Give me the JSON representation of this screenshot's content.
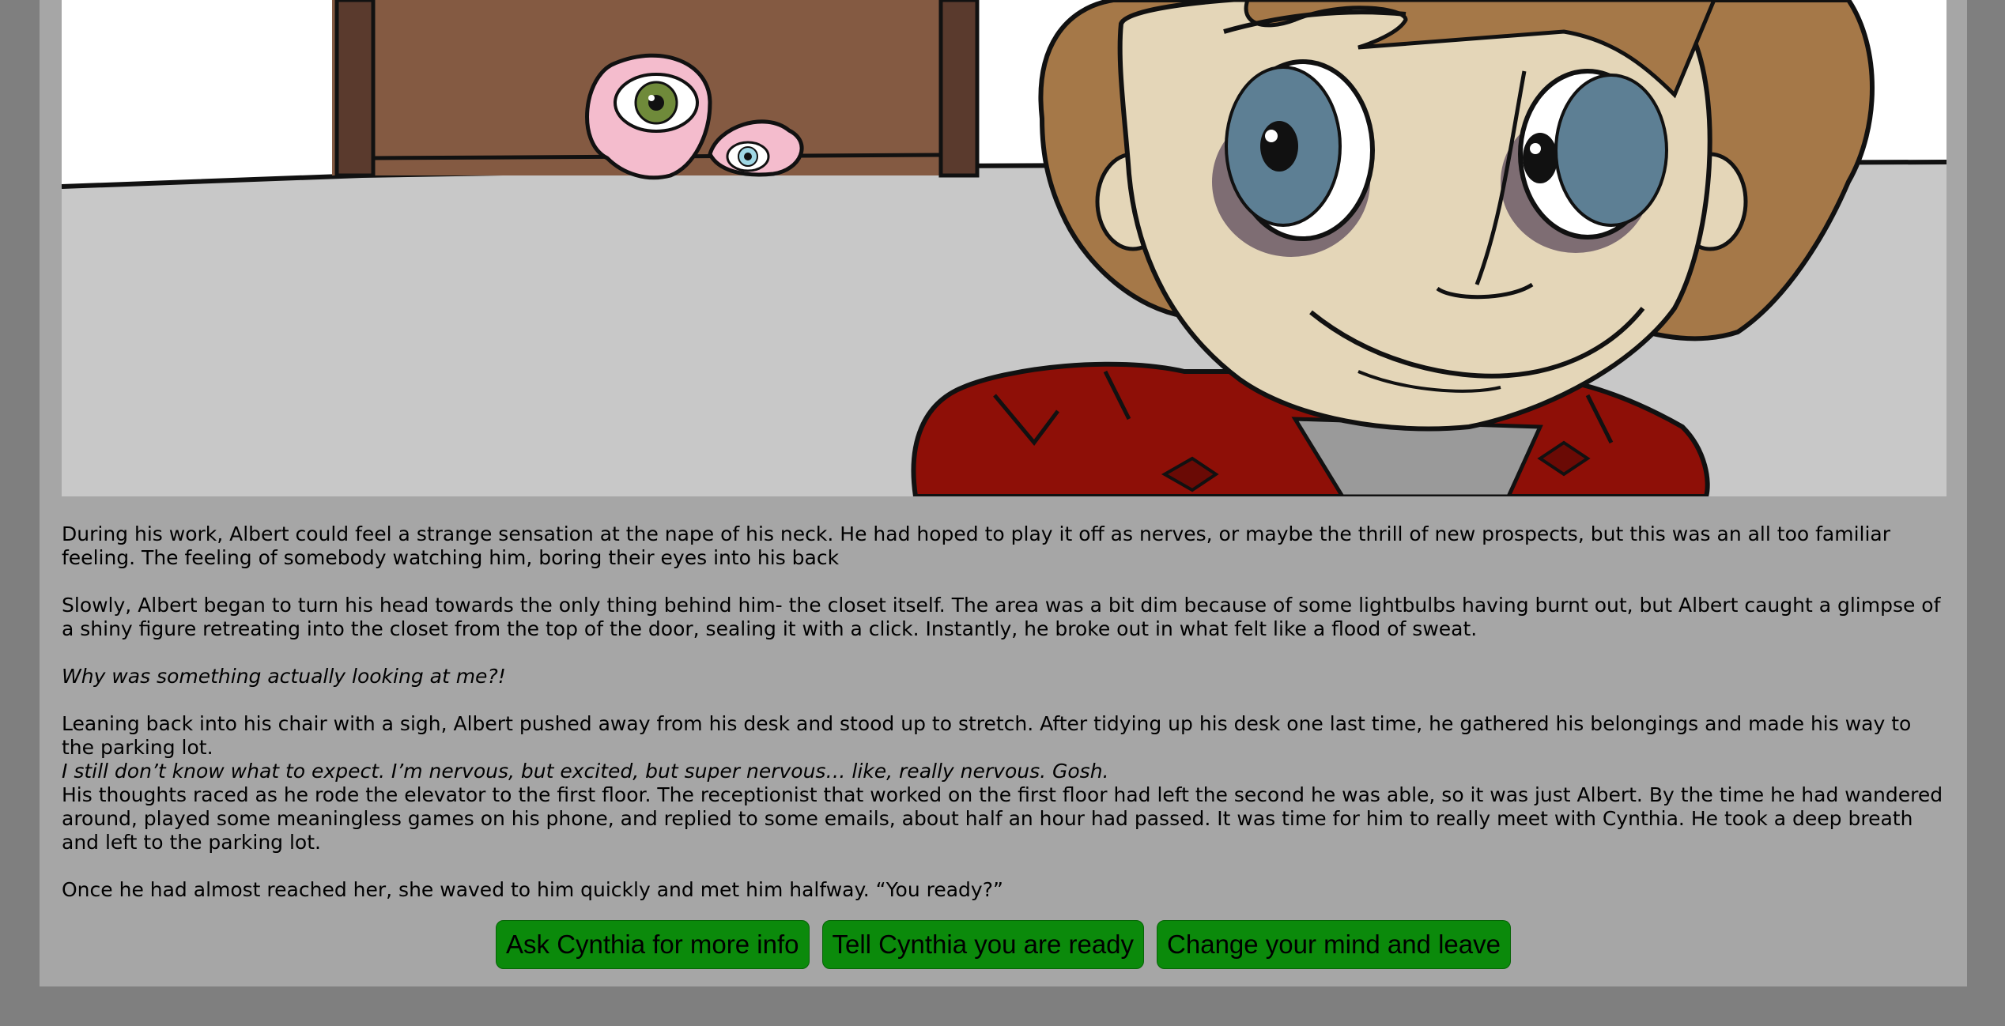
{
  "story": {
    "p1": "During his work, Albert could feel a strange sensation at the nape of his neck. He had hoped to play it off as nerves, or maybe the thrill of new prospects, but this was an all too familiar feeling. The feeling of somebody watching him, boring their eyes into his back",
    "p2": "Slowly, Albert began to turn his head towards the only thing behind him- the closet itself. The area was a bit dim because of some lightbulbs having burnt out, but Albert caught a glimpse of a shiny figure retreating into the closet from the top of the door, sealing it with a click. Instantly, he broke out in what felt like a flood of sweat.",
    "p3_italic": "Why was something actually looking at me?!",
    "p4": "Leaning back into his chair with a sigh, Albert pushed away from his desk and stood up to stretch. After tidying up his desk one last time, he gathered his belongings and made his way to the parking lot.",
    "p5_italic": "I still don’t know what to expect. I’m nervous, but excited, but super nervous… like, really nervous. Gosh.",
    "p6": "His thoughts raced as he rode the elevator to the first floor. The receptionist that worked on the first floor had left the second he was able, so it was just Albert. By the time he had wandered around, played some meaningless games on his phone, and replied to some emails, about half an hour had passed. It was time for him to really meet with Cynthia. He took a deep breath and left to the parking lot.",
    "p7": "Once he had almost reached her, she waved to him quickly and met him halfway. “You ready?”"
  },
  "choices": [
    {
      "label": "Ask Cynthia for more info"
    },
    {
      "label": "Tell Cynthia you are ready"
    },
    {
      "label": "Change your mind and leave"
    }
  ],
  "colors": {
    "page_bg": "#7f7f7f",
    "panel_bg": "#a6a6a6",
    "button_bg": "#0b8a0b"
  }
}
